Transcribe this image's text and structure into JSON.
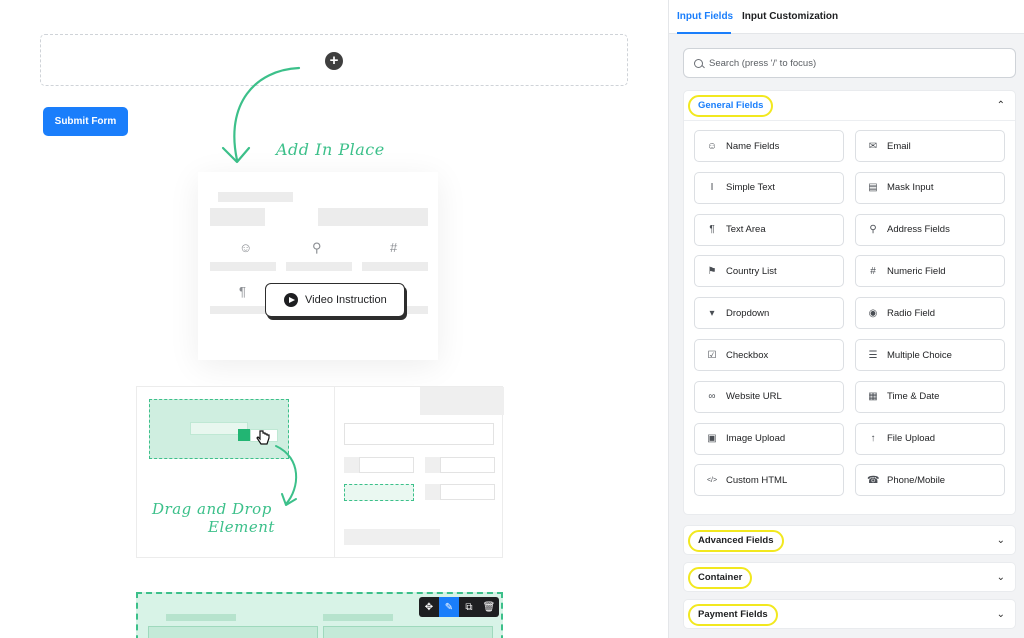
{
  "canvas": {
    "submit_label": "Submit Form",
    "add_in_place_label": "Add In Place",
    "video_button_label": "Video Instruction",
    "drag_drop_line1": "Drag and Drop",
    "drag_drop_line2": "Element"
  },
  "panel": {
    "tabs": [
      {
        "label": "Input Fields",
        "active": true
      },
      {
        "label": "Input Customization",
        "active": false
      }
    ],
    "search": {
      "placeholder": "Search (press '/' to focus)",
      "value": ""
    },
    "sections": {
      "general": {
        "title": "General Fields",
        "expanded": true,
        "fields": [
          {
            "label": "Name Fields",
            "icon": "user-icon"
          },
          {
            "label": "Email",
            "icon": "envelope-icon"
          },
          {
            "label": "Simple Text",
            "icon": "text-cursor-icon"
          },
          {
            "label": "Mask Input",
            "icon": "mask-icon"
          },
          {
            "label": "Text Area",
            "icon": "paragraph-icon"
          },
          {
            "label": "Address Fields",
            "icon": "map-pin-icon"
          },
          {
            "label": "Country List",
            "icon": "flag-icon"
          },
          {
            "label": "Numeric Field",
            "icon": "hash-icon"
          },
          {
            "label": "Dropdown",
            "icon": "dropdown-icon"
          },
          {
            "label": "Radio Field",
            "icon": "radio-icon"
          },
          {
            "label": "Checkbox",
            "icon": "checkbox-icon"
          },
          {
            "label": "Multiple Choice",
            "icon": "list-icon"
          },
          {
            "label": "Website URL",
            "icon": "link-icon"
          },
          {
            "label": "Time & Date",
            "icon": "calendar-icon"
          },
          {
            "label": "Image Upload",
            "icon": "image-icon"
          },
          {
            "label": "File Upload",
            "icon": "upload-icon"
          },
          {
            "label": "Custom HTML",
            "icon": "code-icon"
          },
          {
            "label": "Phone/Mobile",
            "icon": "phone-icon"
          }
        ]
      },
      "advanced": {
        "title": "Advanced Fields",
        "expanded": false
      },
      "container": {
        "title": "Container",
        "expanded": false
      },
      "payment": {
        "title": "Payment Fields",
        "expanded": false
      }
    }
  },
  "colors": {
    "accent": "#1a7efb",
    "highlight": "#f2e81f",
    "handwriting": "#3cc08a"
  }
}
